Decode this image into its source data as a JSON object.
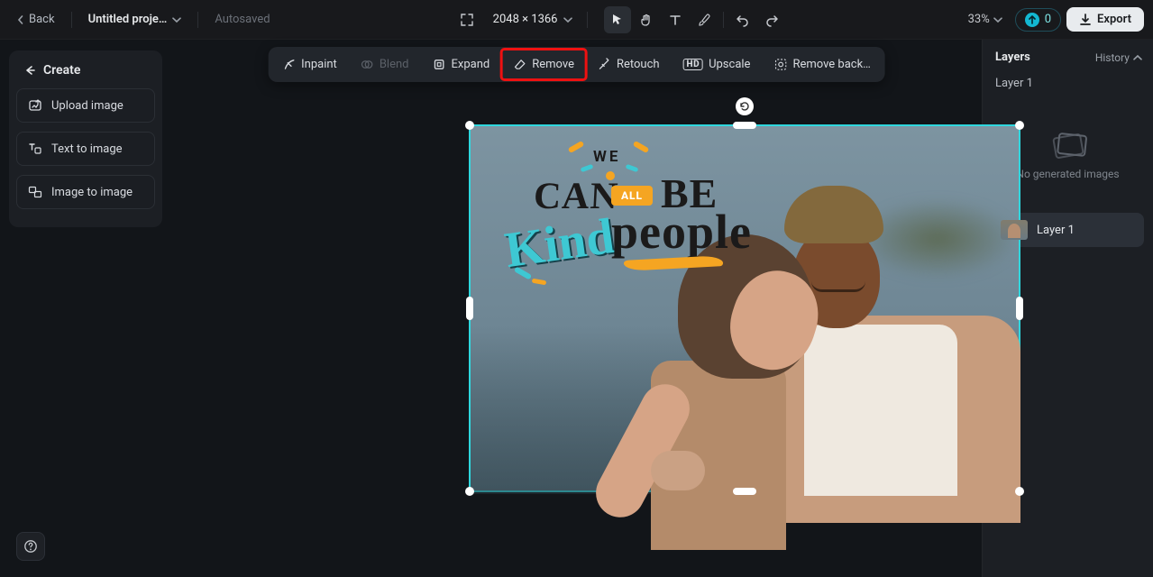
{
  "topbar": {
    "back": "Back",
    "project_name": "Untitled proje…",
    "autosaved": "Autosaved",
    "dimensions": "2048 × 1366",
    "zoom": "33%",
    "credits": "0",
    "export": "Export"
  },
  "create_panel": {
    "title": "Create",
    "upload": "Upload image",
    "text_to_image": "Text to image",
    "image_to_image": "Image to image"
  },
  "action_bar": {
    "inpaint": "Inpaint",
    "blend": "Blend",
    "expand": "Expand",
    "remove": "Remove",
    "retouch": "Retouch",
    "upscale": "Upscale",
    "remove_bg": "Remove back…"
  },
  "canvas_overlay": {
    "we": "WE",
    "can": "CAN",
    "all": "ALL",
    "be": "BE",
    "kind": "Kind",
    "people": "people"
  },
  "right_panel": {
    "layers": "Layers",
    "history": "History",
    "layer1_label": "Layer 1",
    "empty_msg": "No generated images",
    "layer_row": "Layer 1"
  },
  "highlight": {
    "target": "remove-button"
  },
  "colors": {
    "accent_cyan": "#2fd7de",
    "highlight_red": "#e11111",
    "orange": "#f5a522"
  }
}
